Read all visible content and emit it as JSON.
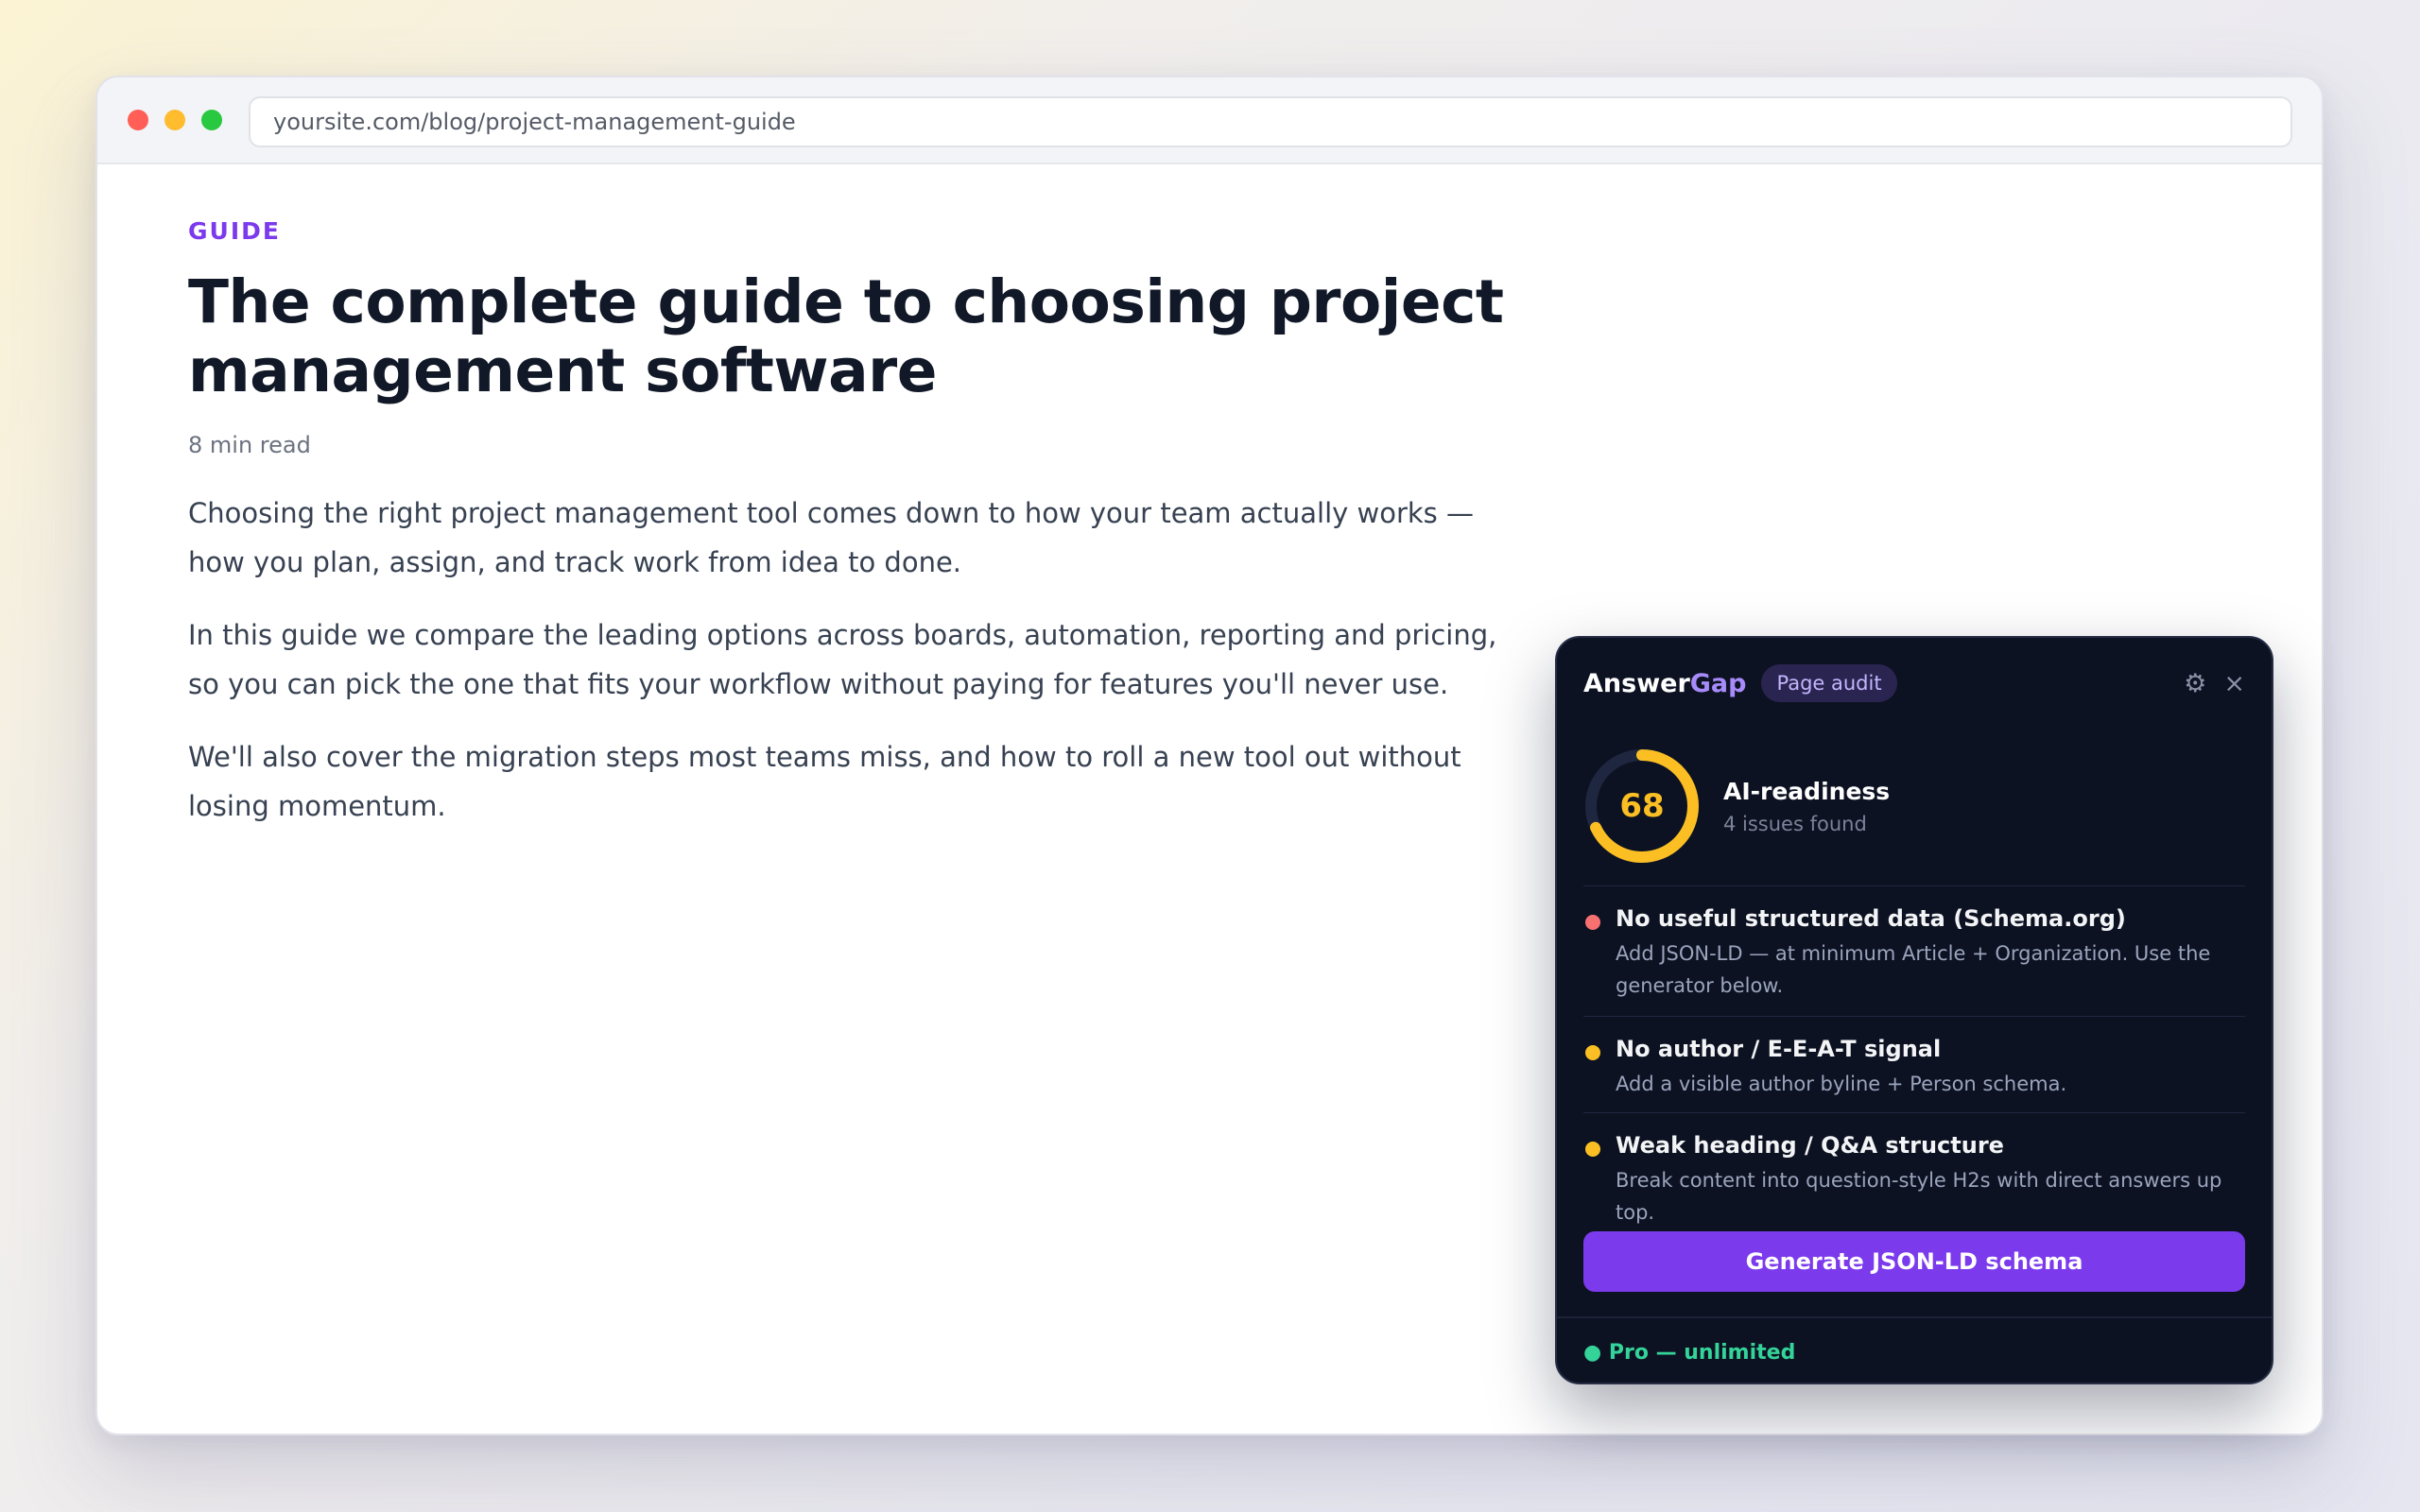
{
  "browser": {
    "url": "yoursite.com/blog/project-management-guide"
  },
  "article": {
    "eyebrow": "GUIDE",
    "title_line1": "The complete guide to choosing project",
    "title_line2": "management software",
    "meta": "8 min read",
    "paragraphs": [
      "Choosing the right project management tool comes down to how your team actually works — how you plan, assign, and track work from idea to done.",
      "In this guide we compare the leading options across boards, automation, reporting and pricing, so you can pick the one that fits your workflow without paying for features you'll never use.",
      "We'll also cover the migration steps most teams miss, and how to roll a new tool out without losing momentum."
    ]
  },
  "panel": {
    "logo_answer": "Answer",
    "logo_gap": "Gap",
    "badge": "Page audit",
    "settings_icon": "gear-icon",
    "close_icon": "close-icon",
    "score": 68,
    "score_fraction": 0.68,
    "score_color": "#fbbf24",
    "readiness_title": "AI-readiness",
    "readiness_subtitle": "4 issues found",
    "issues": [
      {
        "title": "No useful structured data (Schema.org)",
        "description": "Add JSON-LD — at minimum Article + Organization. Use the generator below.",
        "severity_color": "#f87171"
      },
      {
        "title": "No author / E-E-A-T signal",
        "description": "Add a visible author byline + Person schema.",
        "severity_color": "#fbbf24"
      },
      {
        "title": "Weak heading / Q&A structure",
        "description": "Break content into question-style H2s with direct answers up top.",
        "severity_color": "#fbbf24"
      }
    ],
    "cta_label": "Generate JSON-LD schema",
    "plan_status": "● Pro — unlimited",
    "accent_color": "#7c3aed"
  }
}
